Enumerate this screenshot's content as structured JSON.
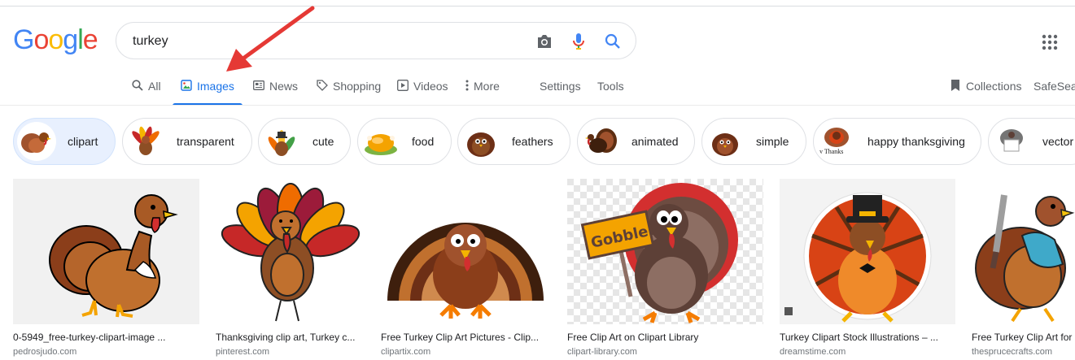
{
  "logo": {
    "letters": [
      "G",
      "o",
      "o",
      "g",
      "l",
      "e"
    ],
    "colors": [
      "#4285f4",
      "#ea4335",
      "#fbbc05",
      "#4285f4",
      "#34a853",
      "#ea4335"
    ]
  },
  "search": {
    "query": "turkey",
    "camera_icon": "camera-icon",
    "mic_icon": "mic-icon",
    "search_icon": "search-icon"
  },
  "apps_icon": "apps-grid-icon",
  "tabs": [
    {
      "label": "All",
      "icon": "search-icon"
    },
    {
      "label": "Images",
      "icon": "image-icon"
    },
    {
      "label": "News",
      "icon": "news-icon"
    },
    {
      "label": "Shopping",
      "icon": "tag-icon"
    },
    {
      "label": "Videos",
      "icon": "play-icon"
    },
    {
      "label": "More",
      "icon": "more-vert-icon"
    }
  ],
  "tools": {
    "settings": "Settings",
    "tools": "Tools",
    "collections": "Collections",
    "safesearch": "SafeSear"
  },
  "chips": [
    {
      "label": "clipart"
    },
    {
      "label": "transparent"
    },
    {
      "label": "cute"
    },
    {
      "label": "food"
    },
    {
      "label": "feathers"
    },
    {
      "label": "animated"
    },
    {
      "label": "simple"
    },
    {
      "label": "happy thanksgiving"
    },
    {
      "label": "vector"
    }
  ],
  "results": [
    {
      "caption": "0-5949_free-turkey-clipart-image ...",
      "source": "pedrosjudo.com"
    },
    {
      "caption": "Thanksgiving clip art, Turkey c...",
      "source": "pinterest.com"
    },
    {
      "caption": "Free Turkey Clip Art Pictures - Clip...",
      "source": "clipartix.com"
    },
    {
      "caption": "Free Clip Art on Clipart Library",
      "source": "clipart-library.com",
      "sign": "Gobble!"
    },
    {
      "caption": "Turkey Clipart Stock Illustrations – ...",
      "source": "dreamstime.com"
    },
    {
      "caption": "Free Turkey Clip Art for",
      "source": "thesprucecrafts.com"
    }
  ],
  "colors": {
    "accent": "#1a73e8",
    "selected_chip": "#e8f0fe",
    "annotation_arrow": "#e53935"
  }
}
